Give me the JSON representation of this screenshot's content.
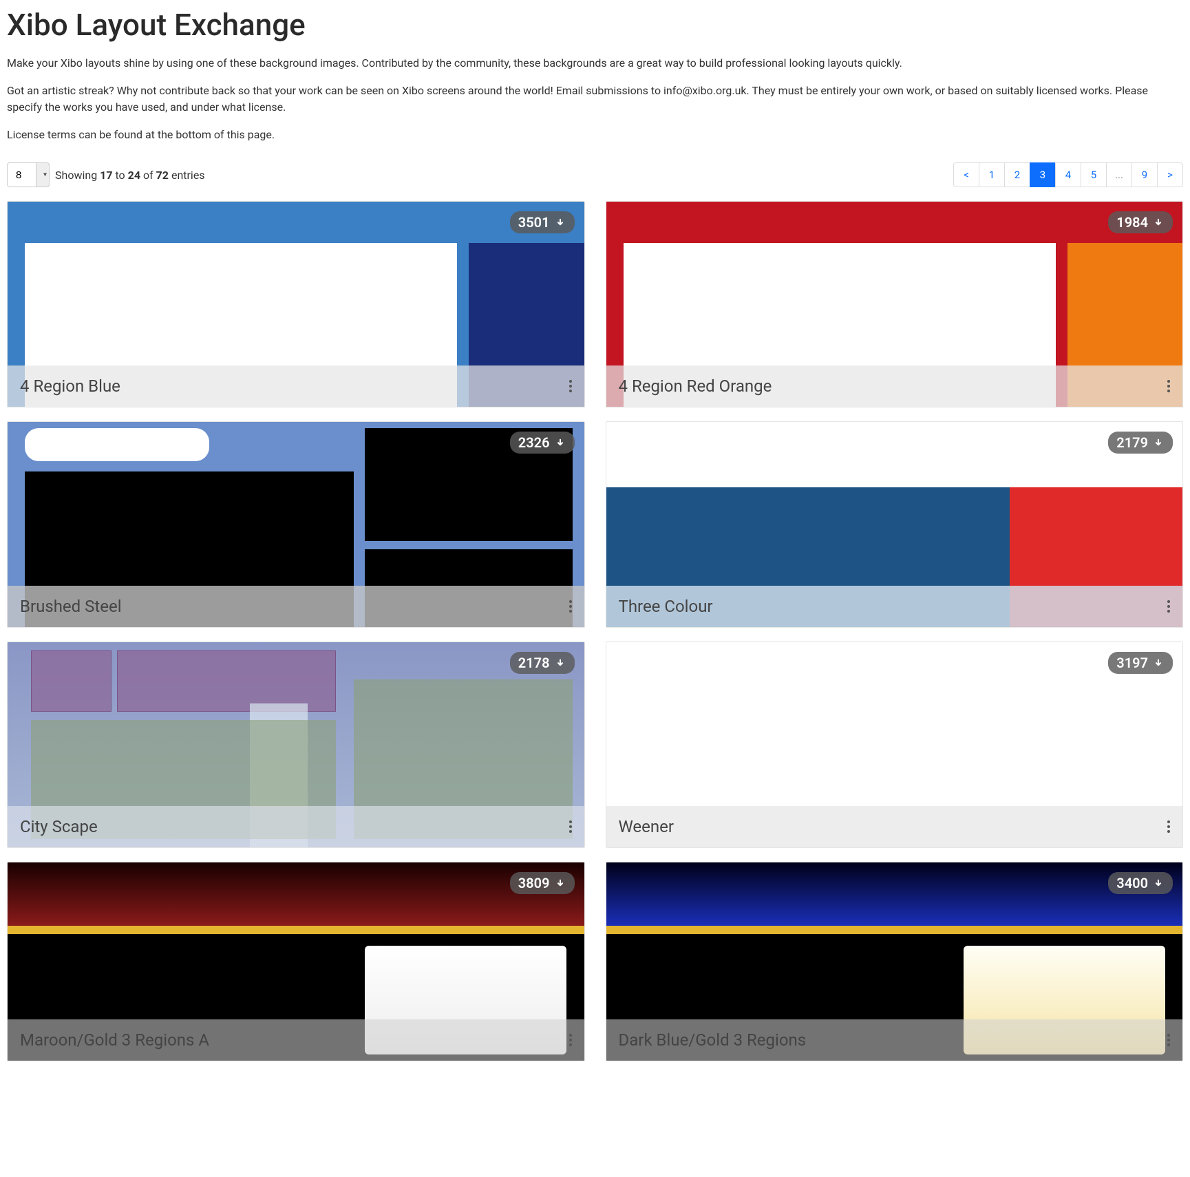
{
  "page": {
    "title": "Xibo Layout Exchange",
    "intro1": "Make your Xibo layouts shine by using one of these background images. Contributed by the community, these backgrounds are a great way to build professional looking layouts quickly.",
    "intro2": "Got an artistic streak? Why not contribute back so that your work can be seen on Xibo screens around the world! Email submissions to info@xibo.org.uk. They must be entirely your own work, or based on suitably licensed works. Please specify the works you have used, and under what license.",
    "intro3": "License terms can be found at the bottom of this page."
  },
  "controls": {
    "page_size": "8",
    "showing_prefix": "Showing ",
    "showing_from": "17",
    "showing_to_word": " to ",
    "showing_to": "24",
    "showing_of_word": " of ",
    "showing_total": "72",
    "showing_suffix": " entries"
  },
  "pagination": {
    "items": [
      {
        "label": "<",
        "active": false
      },
      {
        "label": "1",
        "active": false
      },
      {
        "label": "2",
        "active": false
      },
      {
        "label": "3",
        "active": true
      },
      {
        "label": "4",
        "active": false
      },
      {
        "label": "5",
        "active": false
      },
      {
        "label": "...",
        "active": false,
        "disabled": true
      },
      {
        "label": "9",
        "active": false
      },
      {
        "label": ">",
        "active": false
      }
    ]
  },
  "cards": [
    {
      "title": "4 Region Blue",
      "downloads": "3501",
      "thumb": "thumb-4blue"
    },
    {
      "title": "4 Region Red Orange",
      "downloads": "1984",
      "thumb": "thumb-4red"
    },
    {
      "title": "Brushed Steel",
      "downloads": "2326",
      "thumb": "thumb-steel"
    },
    {
      "title": "Three Colour",
      "downloads": "2179",
      "thumb": "thumb-3col"
    },
    {
      "title": "City Scape",
      "downloads": "2178",
      "thumb": "thumb-city"
    },
    {
      "title": "Weener",
      "downloads": "3197",
      "thumb": "thumb-weener"
    },
    {
      "title": "Maroon/Gold 3 Regions A",
      "downloads": "3809",
      "thumb": "thumb-maroon"
    },
    {
      "title": "Dark Blue/Gold 3 Regions",
      "downloads": "3400",
      "thumb": "thumb-darkblue"
    }
  ]
}
